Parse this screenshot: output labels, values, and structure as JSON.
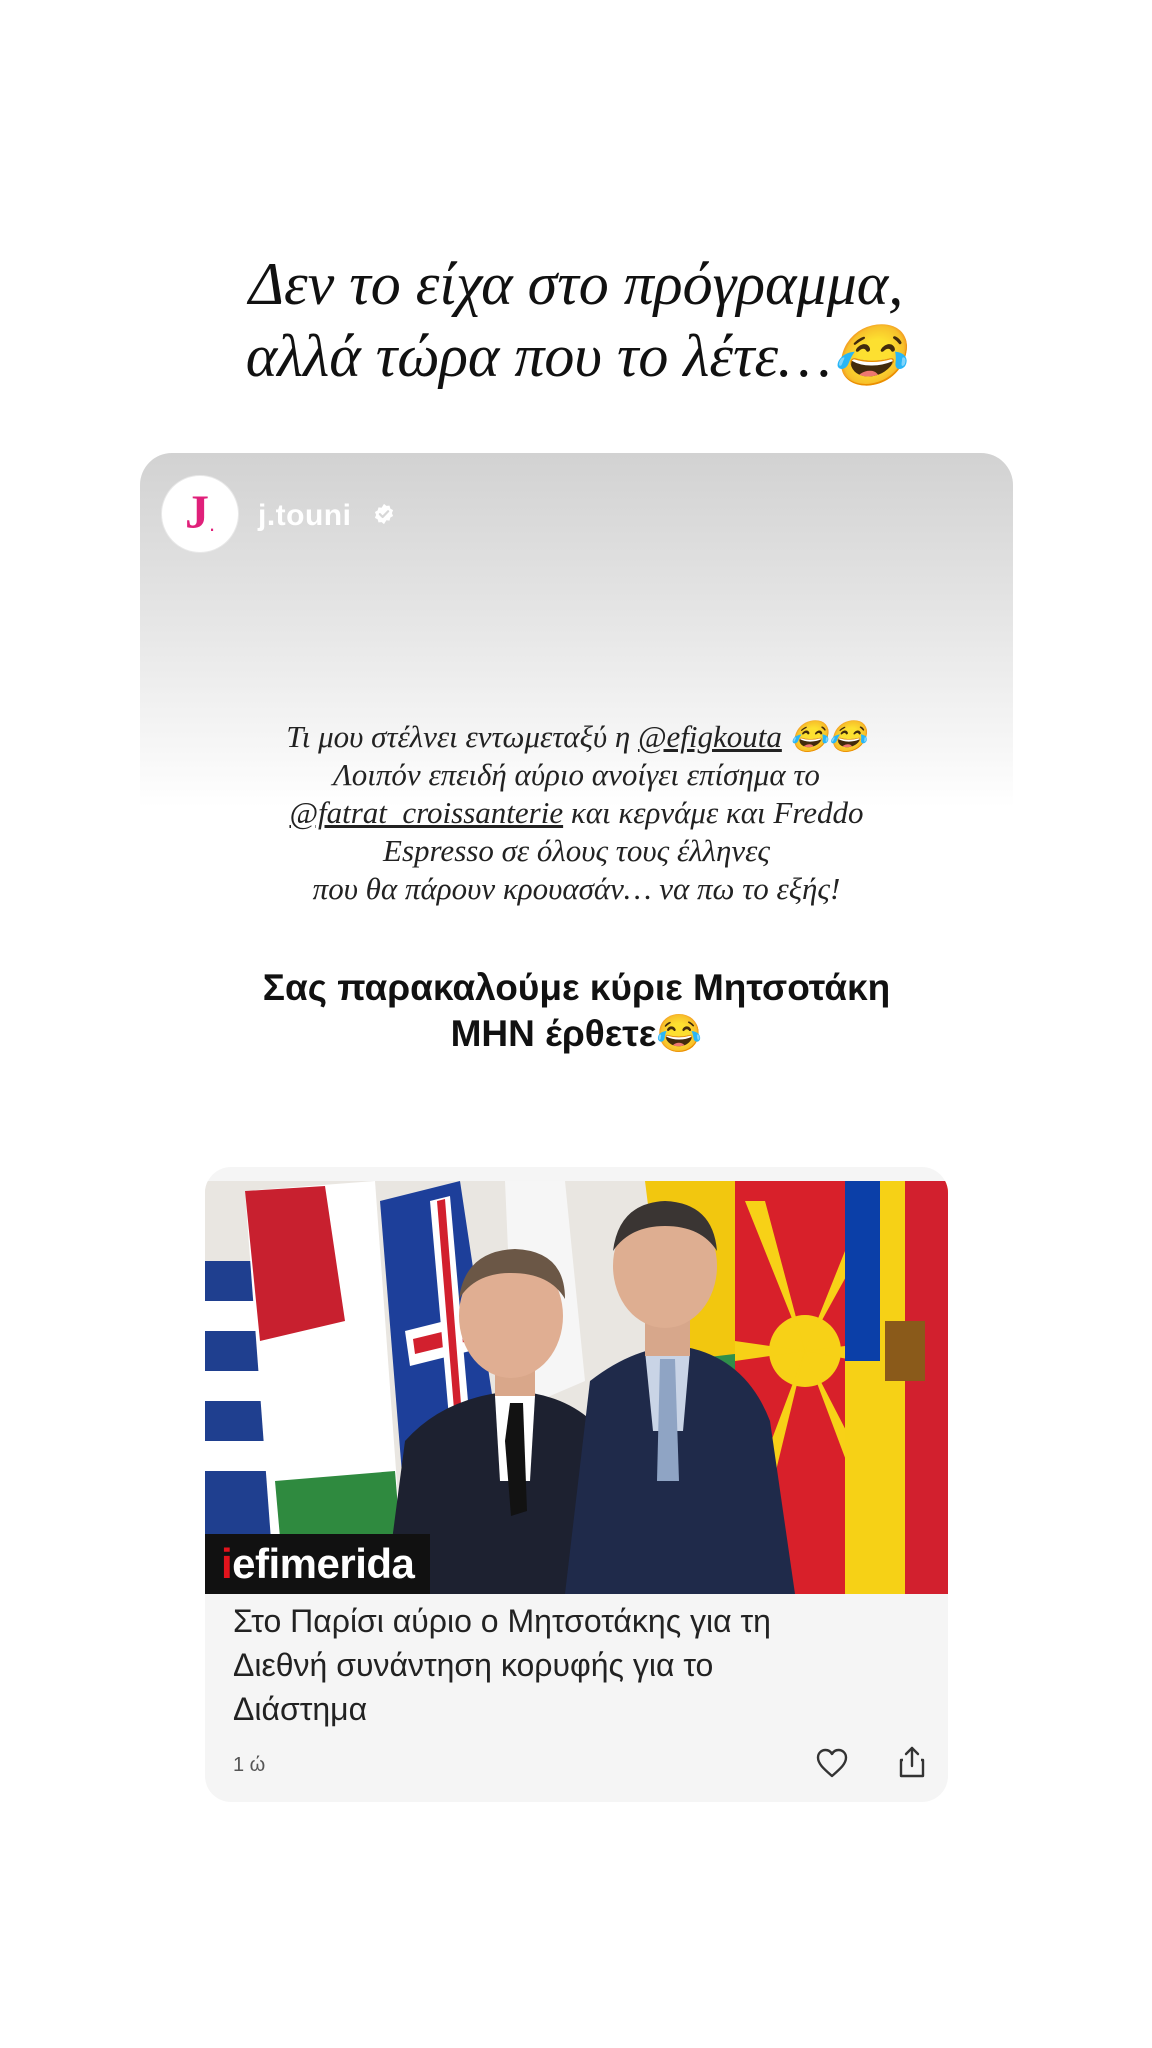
{
  "caption": {
    "line1": "Δεν το είχα στο πρόγραμμα,",
    "line2": "αλλά τώρα που το λέτε…😂"
  },
  "story": {
    "avatar_letter": "J",
    "avatar_dot": ".",
    "username": "j.touni",
    "verified_icon": "verified-badge-icon",
    "text_line1_a": "Τι μου στέλνει εντωμεταξύ η ",
    "text_line1_mention": "@efigkouta",
    "text_line1_b": " 😂😂",
    "text_line2": "Λοιπόν επειδή αύριο ανοίγει επίσημα το",
    "text_line3_mention": "@fatrat_croissanterie",
    "text_line3_b": " και κερνάμε και Freddo",
    "text_line4": "Espresso σε όλους τους έλληνες",
    "text_line5": "που θα πάρουν κρουασάν… να πω το εξής!",
    "headline_line1": "Σας παρακαλούμε κύριε Μητσοτάκη",
    "headline_line2": "ΜΗΝ έρθετε😂"
  },
  "news": {
    "source_accent": "i",
    "source_rest": "efimerida",
    "image_subject": "two-leaders-in-front-of-flags",
    "title_line1": "Στο Παρίσι αύριο ο Μητσοτάκης για τη",
    "title_line2": "Διεθνή συνάντηση κορυφής για το",
    "title_line3": "Διάστημα",
    "time": "1 ώ",
    "like_icon": "heart-icon",
    "share_icon": "share-icon"
  },
  "colors": {
    "brand_pink": "#e0207a",
    "source_red": "#e2131c",
    "card_gray": "#f5f5f5"
  }
}
